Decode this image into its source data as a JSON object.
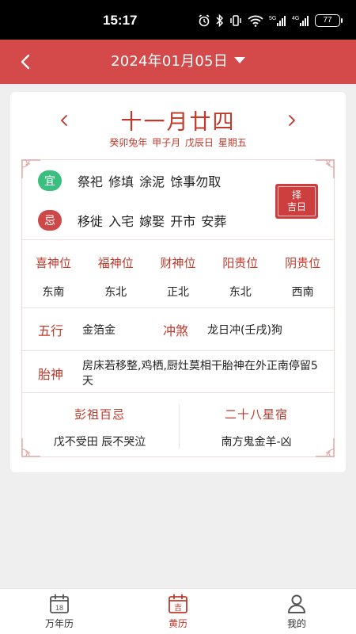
{
  "status_bar": {
    "time": "15:17",
    "battery": "77",
    "icons": [
      "alarm-icon",
      "bluetooth-icon",
      "vibrate-icon",
      "wifi-icon",
      "5g-signal-icon",
      "4g-signal-icon"
    ]
  },
  "header": {
    "date": "2024年01月05日",
    "background_color": "#d44a4a"
  },
  "lunar": {
    "date": "十一月廿四",
    "ganzhi": "癸卯兔年  甲子月  戊辰日  星期五"
  },
  "yi": {
    "badge": "宜",
    "items": "祭祀 修填 涂泥 馀事勿取"
  },
  "ji": {
    "badge": "忌",
    "items": "移徙 入宅 嫁娶 开市 安葬"
  },
  "zeji": {
    "line1": "择",
    "line2": "吉日"
  },
  "gods": [
    {
      "name": "喜神位",
      "dir": "东南"
    },
    {
      "name": "福神位",
      "dir": "东北"
    },
    {
      "name": "财神位",
      "dir": "正北"
    },
    {
      "name": "阳贵位",
      "dir": "东北"
    },
    {
      "name": "阴贵位",
      "dir": "西南"
    }
  ],
  "wuxing": {
    "label": "五行",
    "value": "金箔金"
  },
  "chongsha": {
    "label": "冲煞",
    "value": "龙日冲(壬戌)狗"
  },
  "taishen": {
    "label": "胎神",
    "value": "房床若移整,鸡栖,厨灶莫相干胎神在外正南停留5天"
  },
  "pengzu": {
    "title": "彭祖百忌",
    "value": "戊不受田 辰不哭泣"
  },
  "xingxiu": {
    "title": "二十八星宿",
    "value": "南方鬼金羊-凶"
  },
  "bottom_nav": [
    {
      "label": "万年历",
      "icon": "calendar-icon",
      "icon_text": "18",
      "active": false
    },
    {
      "label": "黄历",
      "icon": "almanac-icon",
      "icon_text": "吉",
      "active": true
    },
    {
      "label": "我的",
      "icon": "person-icon",
      "active": false
    }
  ],
  "colors": {
    "accent": "#c0392b",
    "yi_green": "#3bbf7e",
    "ji_red": "#cd4848"
  }
}
